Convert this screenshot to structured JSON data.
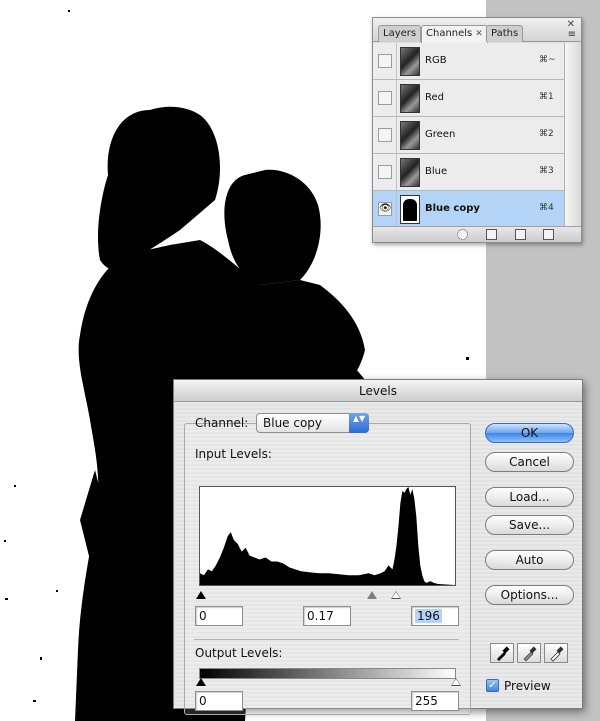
{
  "channels_panel": {
    "tabs": [
      {
        "label": "Layers",
        "active": false
      },
      {
        "label": "Channels",
        "active": true,
        "close": "✕"
      },
      {
        "label": "Paths",
        "active": false
      }
    ],
    "close_icon": "✕",
    "menu_icon": "≡",
    "channels": [
      {
        "name": "RGB",
        "shortcut": "⌘~",
        "visible": false,
        "selected": false
      },
      {
        "name": "Red",
        "shortcut": "⌘1",
        "visible": false,
        "selected": false
      },
      {
        "name": "Green",
        "shortcut": "⌘2",
        "visible": false,
        "selected": false
      },
      {
        "name": "Blue",
        "shortcut": "⌘3",
        "visible": false,
        "selected": false
      },
      {
        "name": "Blue copy",
        "shortcut": "⌘4",
        "visible": true,
        "selected": true
      }
    ],
    "eye_icon": "👁",
    "footer_icons": [
      "load-selection-icon",
      "save-selection-icon",
      "new-channel-icon",
      "trash-icon"
    ]
  },
  "levels": {
    "title": "Levels",
    "channel_label": "Channel:",
    "channel_value": "Blue copy",
    "select_arrows": "▲▼",
    "input_levels_label": "Input Levels:",
    "input_black": "0",
    "input_gamma": "0.17",
    "input_white": "196",
    "output_levels_label": "Output Levels:",
    "output_black": "0",
    "output_white": "255",
    "buttons": {
      "ok": "OK",
      "cancel": "Cancel",
      "load": "Load...",
      "save": "Save...",
      "auto": "Auto",
      "options": "Options..."
    },
    "preview_label": "Preview",
    "preview_checked": true,
    "check_mark": "✓",
    "eyedropper_icons": [
      "black-eyedropper-icon",
      "gray-eyedropper-icon",
      "white-eyedropper-icon"
    ]
  },
  "colors": {
    "selection_blue": "#b3d3f7",
    "background_gray": "#c2c2c2",
    "silhouette": "#000000"
  }
}
